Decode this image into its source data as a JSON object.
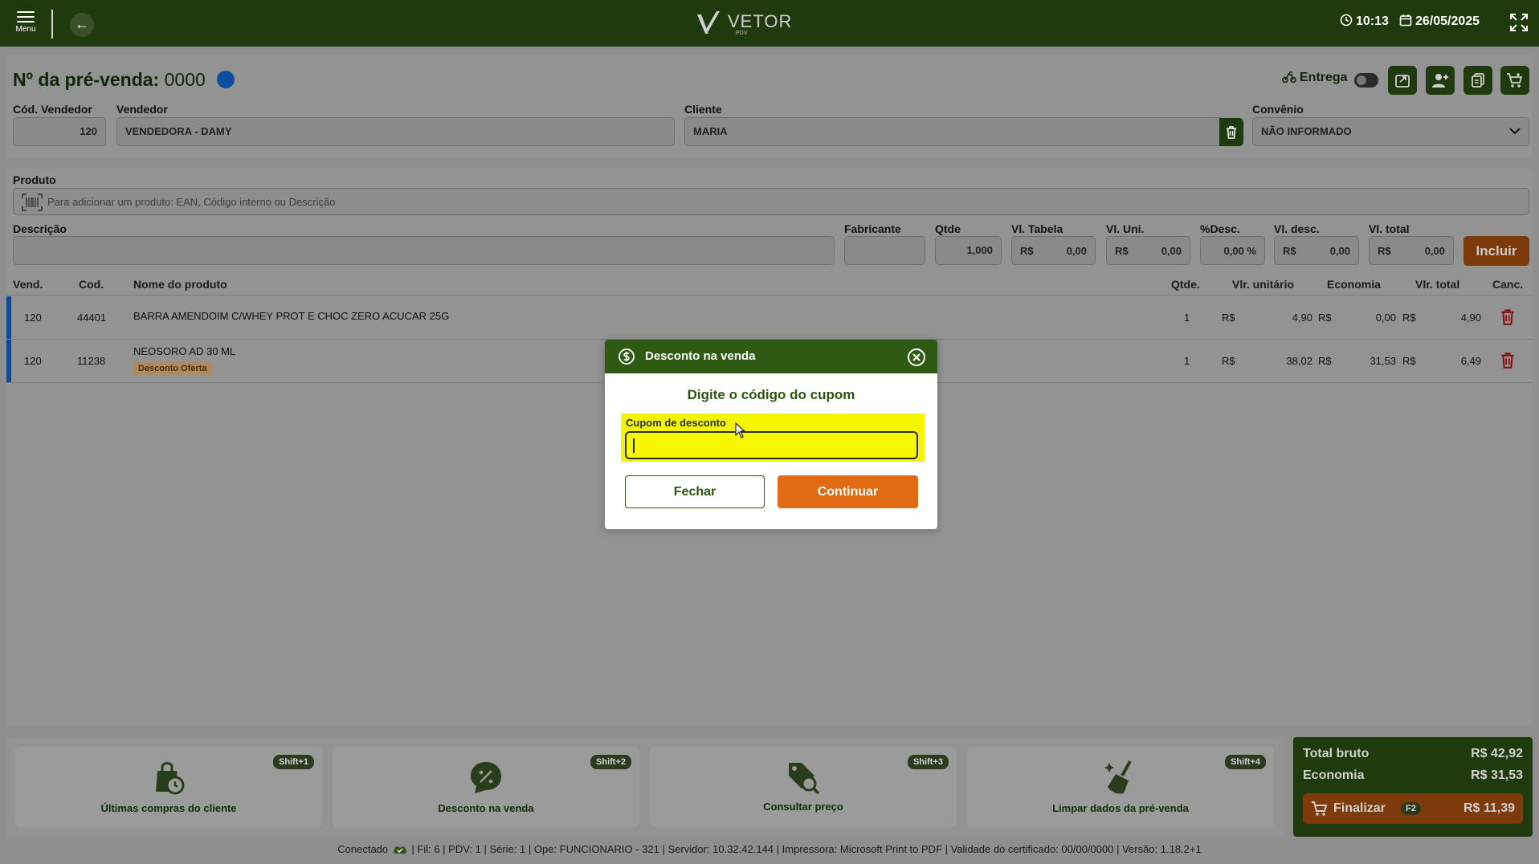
{
  "topbar": {
    "menu_label": "Menu",
    "logo_name": "VETOR",
    "logo_sub": "PDV",
    "time": "10:13",
    "date": "26/05/2025"
  },
  "header": {
    "title": "Nº da pré-venda:",
    "number": "0000",
    "entrega_label": "Entrega",
    "entrega_enabled": false
  },
  "form": {
    "cod_vendedor_label": "Cód. Vendedor",
    "cod_vendedor_value": "120",
    "vendedor_label": "Vendedor",
    "vendedor_value": "VENDEDORA - DAMY",
    "cliente_label": "Cliente",
    "cliente_value": "MARIA",
    "convenio_label": "Convênio",
    "convenio_value": "NÃO INFORMADO"
  },
  "produto": {
    "label": "Produto",
    "placeholder": "Para adicionar um produto: EAN, Código interno ou Descrição",
    "descricao_label": "Descrição",
    "fabricante_label": "Fabricante",
    "qtde_label": "Qtde",
    "qtde_value": "1,000",
    "vl_tabela_label": "Vl. Tabela",
    "vl_tabela_value": "0,00",
    "vl_uni_label": "Vl. Uni.",
    "vl_uni_value": "0,00",
    "pct_desc_label": "%Desc.",
    "pct_desc_value": "0,00 %",
    "vl_desc_label": "Vl. desc.",
    "vl_desc_value": "0,00",
    "vl_total_label": "Vl. total",
    "vl_total_value": "0,00",
    "currency": "R$",
    "incluir_label": "Incluir"
  },
  "table": {
    "headers": {
      "vend": "Vend.",
      "cod": "Cod.",
      "nome": "Nome do produto",
      "qtde": "Qtde.",
      "vlr_unit": "Vlr. unitário",
      "economia": "Economia",
      "vlr_total": "Vlr. total",
      "canc": "Canc."
    },
    "rows": [
      {
        "vend": "120",
        "cod": "44401",
        "nome": "BARRA AMENDOIM C/WHEY PROT E CHOC ZERO ACUCAR 25G",
        "tag": "",
        "qtde": "1",
        "vlr_unit": "4,90",
        "economia": "0,00",
        "vlr_total": "4,90"
      },
      {
        "vend": "120",
        "cod": "11238",
        "nome": "NEOSORO AD 30 ML",
        "tag": "Desconto Oferta",
        "qtde": "1",
        "vlr_unit": "38,02",
        "economia": "31,53",
        "vlr_total": "6,49"
      }
    ]
  },
  "actions": [
    {
      "label": "Últimas compras do cliente",
      "shortcut": "Shift+1",
      "icon": "shopping-bag-clock-icon"
    },
    {
      "label": "Desconto na venda",
      "shortcut": "Shift+2",
      "icon": "discount-badge-icon"
    },
    {
      "label": "Consultar preço",
      "shortcut": "Shift+3",
      "icon": "price-tag-search-icon"
    },
    {
      "label": "Limpar dados da pré-venda",
      "shortcut": "Shift+4",
      "icon": "broom-icon"
    }
  ],
  "totals": {
    "bruto_label": "Total bruto",
    "bruto_value": "R$ 42,92",
    "economia_label": "Economia",
    "economia_value": "R$ 31,53",
    "finalizar_label": "Finalizar",
    "finalizar_key": "F2",
    "finalizar_value": "R$ 11,39"
  },
  "statusbar": {
    "connected": "Conectado",
    "info": "| Fil: 6 | PDV: 1 | Série: 1 | Ope: FUNCIONARIO - 321 | Servidor: 10.32.42.144 | Impressora: Microsoft Print to PDF | Validade do certificado: 00/00/0000 | Versão: 1.18.2+1"
  },
  "modal": {
    "title": "Desconto na venda",
    "subtitle": "Digite o código do cupom",
    "field_label": "Cupom de desconto",
    "field_value": "",
    "close_label": "Fechar",
    "continue_label": "Continuar"
  },
  "colors": {
    "header_green": "#1f3a0d",
    "modal_green": "#2f5a14",
    "accent_orange": "#e06b12",
    "highlight_yellow": "#f5f500",
    "row_blue": "#0b4b9a",
    "delete_red": "#8a1010"
  }
}
